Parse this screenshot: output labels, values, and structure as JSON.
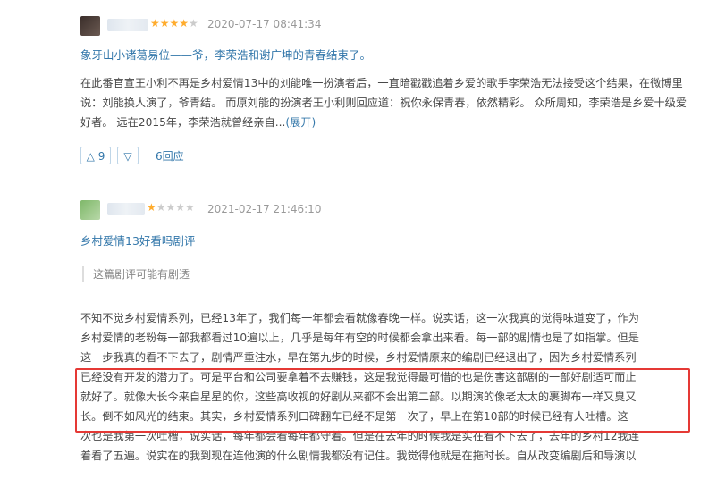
{
  "review1": {
    "rating": 4,
    "date": "2020-07-17 08:41:34",
    "title": "象牙山小诸葛易位——爷，李荣浩和谢广坤的青春结束了。",
    "body": "在此番官宣王小利不再是乡村爱情13中的刘能唯一扮演者后，一直暗戳戳追着乡爱的歌手李荣浩无法接受这个结果，在微博里说：刘能换人演了，爷青结。 而原刘能的扮演者王小利则回应道：祝你永保青春，依然精彩。 众所周知，李荣浩是乡爱十级爱好者。 远在2015年，李荣浩就曾经亲自...",
    "expand": "(展开)",
    "upvote": "△ 9",
    "downvote": "▽",
    "replies": "6回应"
  },
  "review2": {
    "rating": 1,
    "date": "2021-02-17 21:46:10",
    "title": "乡村爱情13好看吗剧评",
    "spoiler_notice": "这篇剧评可能有剧透",
    "lines": [
      "不知不觉乡村爱情系列，已经13年了，我们每一年都会看就像春晚一样。说实话，这一次我真的觉得味道变了，作为",
      "乡村爱情的老粉每一部我都看过10遍以上，几乎是每年有空的时候都会拿出来看。每一部的剧情也是了如指掌。但是",
      "这一步我真的看不下去了，剧情严重注水，早在第九步的时候，乡村爱情原来的编剧已经退出了，因为乡村爱情系列",
      "已经没有开发的潜力了。可是平台和公司要拿着不去赚钱，这是我觉得最可惜的也是伤害这部剧的一部好剧适可而止",
      "就好了。就像大长今来自星星的你，这些高收视的好剧从来都不会出第二部。以期演的像老太太的裹脚布一样又臭又",
      "长。倒不如风光的结束。其实，乡村爱情系列口碑翻车已经不是第一次了，早上在第10部的时候已经有人吐槽。这一",
      "次也是我第一次吐槽，说实话，每年都会看每年都守着。但是在去年的时候我是实在看不下去了，去年的乡村12我连",
      "着看了五遍。说实在的我到现在连他演的什么剧情我都没有记住。我觉得他就是在拖时长。自从改变编剧后和导演以"
    ]
  }
}
